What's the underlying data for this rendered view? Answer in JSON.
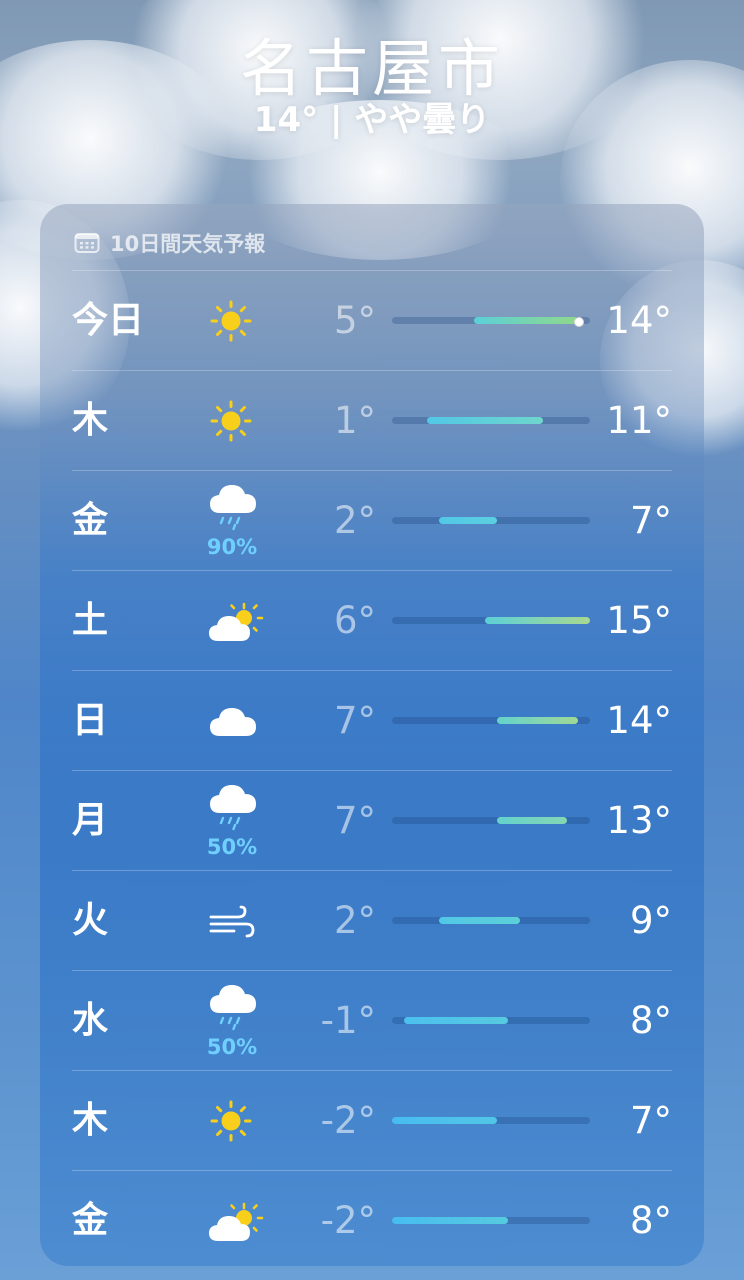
{
  "header": {
    "city": "名古屋市",
    "current": "14° | やや曇り"
  },
  "forecast": {
    "title": "10日間天気予報",
    "scale": {
      "min": -2,
      "max": 15
    },
    "days": [
      {
        "day": "今日",
        "icon": "sun-icon",
        "precip": "",
        "low": "5°",
        "high": "14°",
        "low_val": 5,
        "high_val": 14,
        "current_val": 14,
        "colors": [
          "#5ccfd8",
          "#8fd98a"
        ]
      },
      {
        "day": "木",
        "icon": "sun-icon",
        "precip": "",
        "low": "1°",
        "high": "11°",
        "low_val": 1,
        "high_val": 11,
        "colors": [
          "#52c8e6",
          "#6fd6cc"
        ]
      },
      {
        "day": "金",
        "icon": "cloud-rain-icon",
        "precip": "90%",
        "low": "2°",
        "high": "7°",
        "low_val": 2,
        "high_val": 7,
        "colors": [
          "#52c8e6",
          "#5ccfe0"
        ]
      },
      {
        "day": "土",
        "icon": "partly-sunny-icon",
        "precip": "",
        "low": "6°",
        "high": "15°",
        "low_val": 6,
        "high_val": 15,
        "colors": [
          "#5ccfd8",
          "#a8d890"
        ]
      },
      {
        "day": "日",
        "icon": "cloud-icon",
        "precip": "",
        "low": "7°",
        "high": "14°",
        "low_val": 7,
        "high_val": 14,
        "colors": [
          "#64d2cc",
          "#9fd896"
        ]
      },
      {
        "day": "月",
        "icon": "cloud-rain-icon",
        "precip": "50%",
        "low": "7°",
        "high": "13°",
        "low_val": 7,
        "high_val": 13,
        "colors": [
          "#64d2cc",
          "#84d6b4"
        ]
      },
      {
        "day": "火",
        "icon": "wind-icon",
        "precip": "",
        "low": "2°",
        "high": "9°",
        "low_val": 2,
        "high_val": 9,
        "colors": [
          "#52c8e6",
          "#5ccfd8"
        ]
      },
      {
        "day": "水",
        "icon": "cloud-rain-icon",
        "precip": "50%",
        "low": "-1°",
        "high": "8°",
        "low_val": -1,
        "high_val": 8,
        "colors": [
          "#4cc0ee",
          "#56cadf"
        ]
      },
      {
        "day": "木",
        "icon": "sun-icon",
        "precip": "",
        "low": "-2°",
        "high": "7°",
        "low_val": -2,
        "high_val": 7,
        "colors": [
          "#48bcf0",
          "#52c6e6"
        ]
      },
      {
        "day": "金",
        "icon": "partly-sunny-icon",
        "precip": "",
        "low": "-2°",
        "high": "8°",
        "low_val": -2,
        "high_val": 8,
        "colors": [
          "#48bcf0",
          "#56cadf"
        ]
      }
    ]
  }
}
